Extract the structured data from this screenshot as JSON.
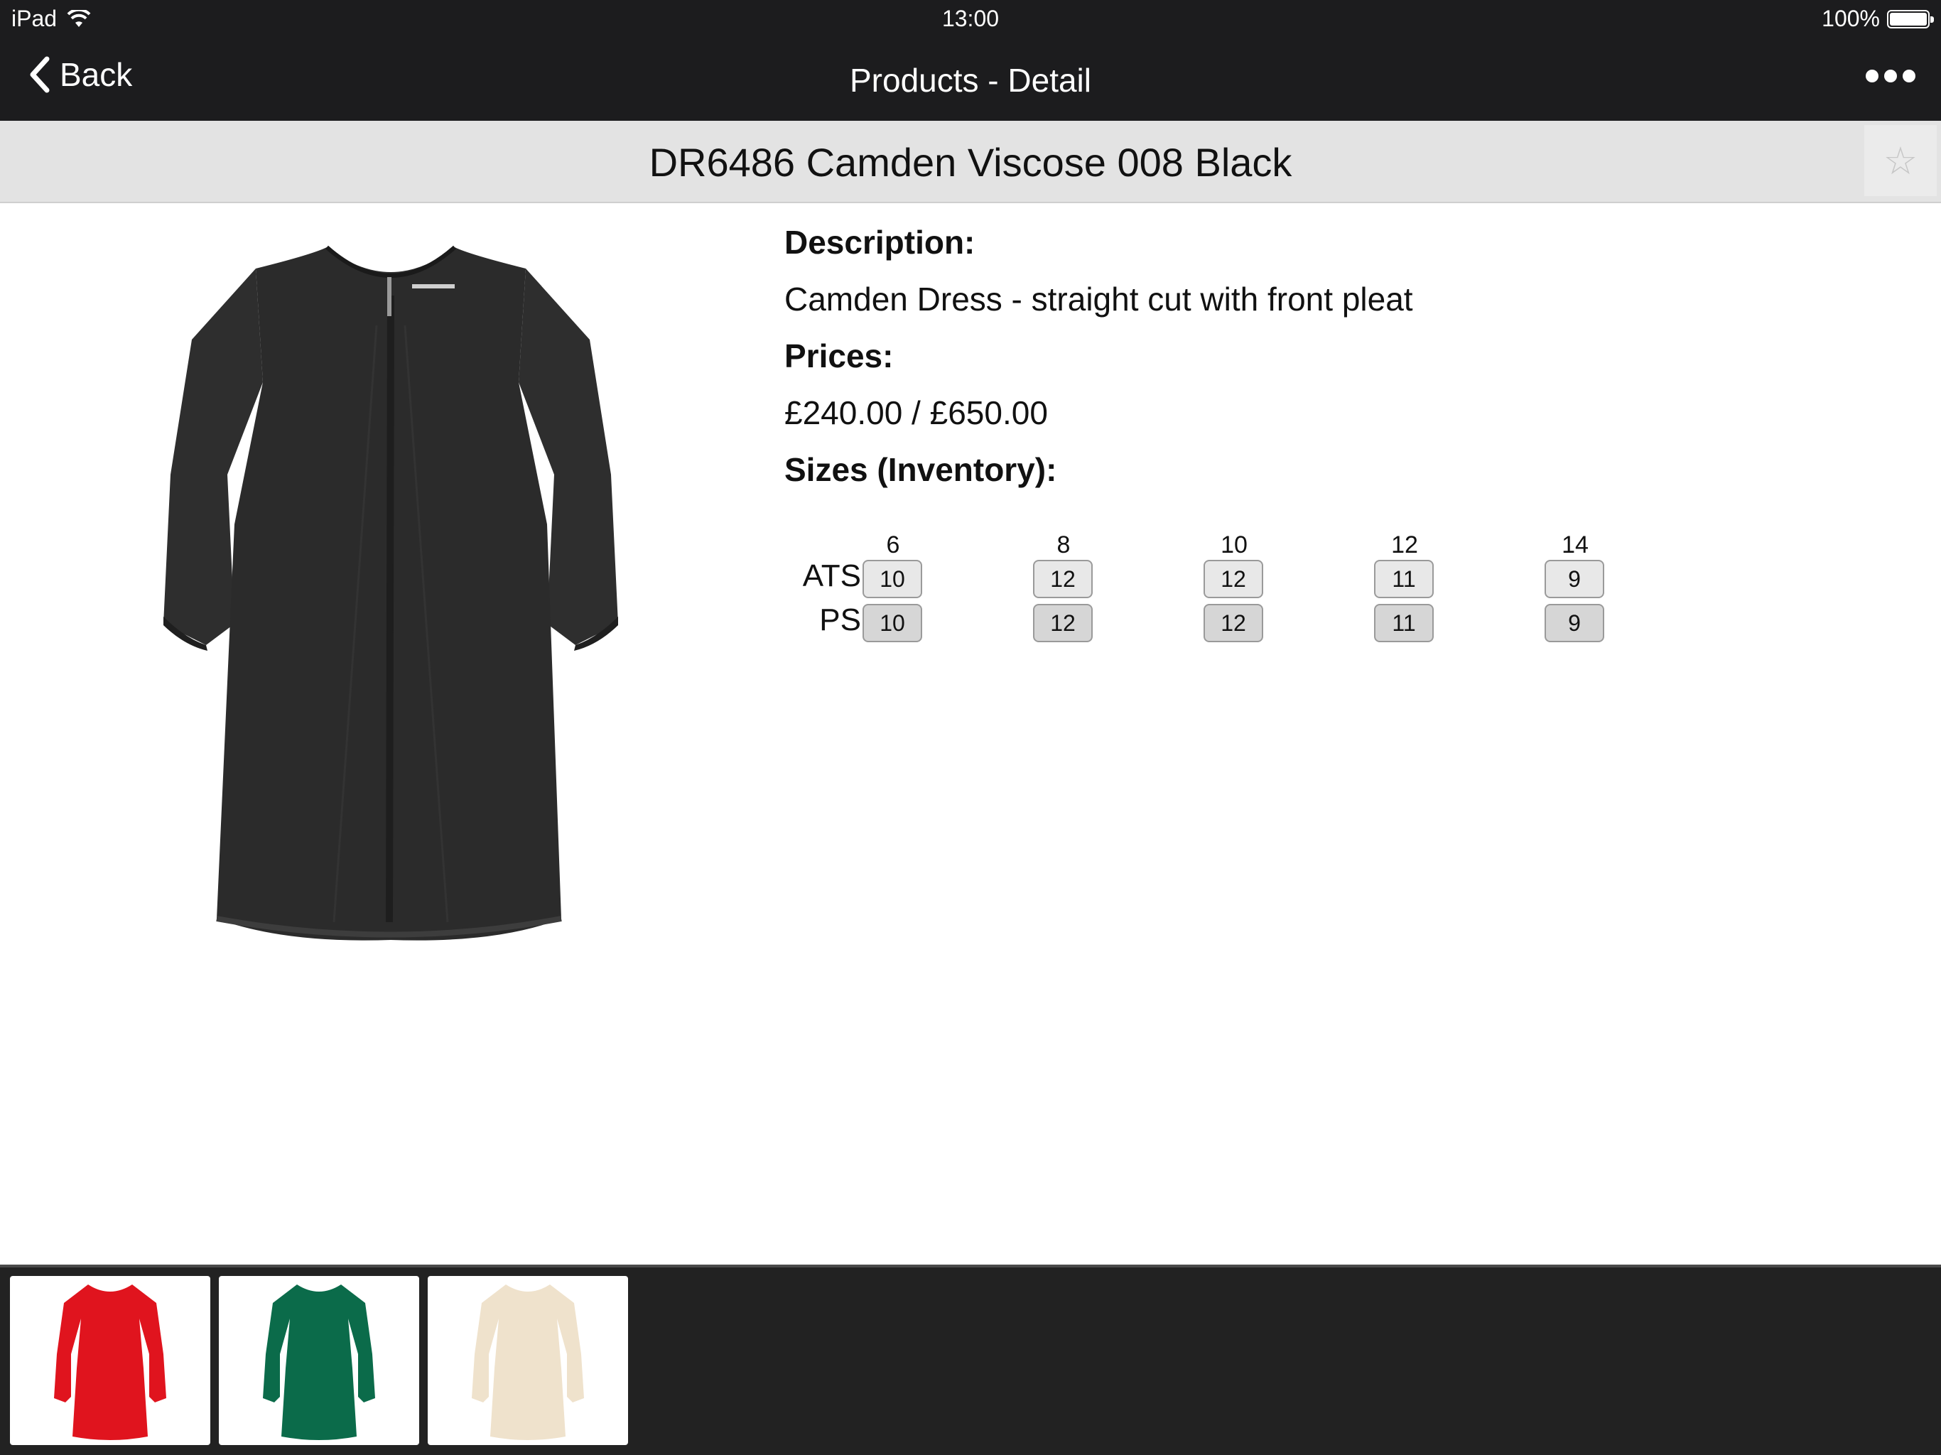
{
  "status_bar": {
    "device": "iPad",
    "time": "13:00",
    "battery": "100%",
    "battery_level": 1.0
  },
  "nav": {
    "back_label": "Back",
    "title": "Products - Detail",
    "more_icon": "more-icon"
  },
  "product": {
    "title": "DR6486 Camden Viscose 008 Black",
    "description_label": "Description:",
    "description": "Camden Dress - straight cut with front pleat",
    "prices_label": "Prices:",
    "prices": "£240.00 / £650.00",
    "sizes_label": "Sizes (Inventory):",
    "favorite_icon": "star-icon"
  },
  "inventory": {
    "sizes": [
      "6",
      "8",
      "10",
      "12",
      "14"
    ],
    "rows": [
      {
        "label": "ATS",
        "values": [
          "10",
          "12",
          "12",
          "11",
          "9"
        ]
      },
      {
        "label": "PS",
        "values": [
          "10",
          "12",
          "12",
          "11",
          "9"
        ]
      }
    ]
  },
  "variants": [
    {
      "name": "red-dress",
      "color": "#e0141e"
    },
    {
      "name": "green-dress",
      "color": "#0b6b4a"
    },
    {
      "name": "cream-dress",
      "color": "#efe2cc"
    }
  ],
  "colors": {
    "bar": "#1c1c1e",
    "title_bar": "#e3e3e3",
    "dress_main": "#2b2b2b"
  }
}
